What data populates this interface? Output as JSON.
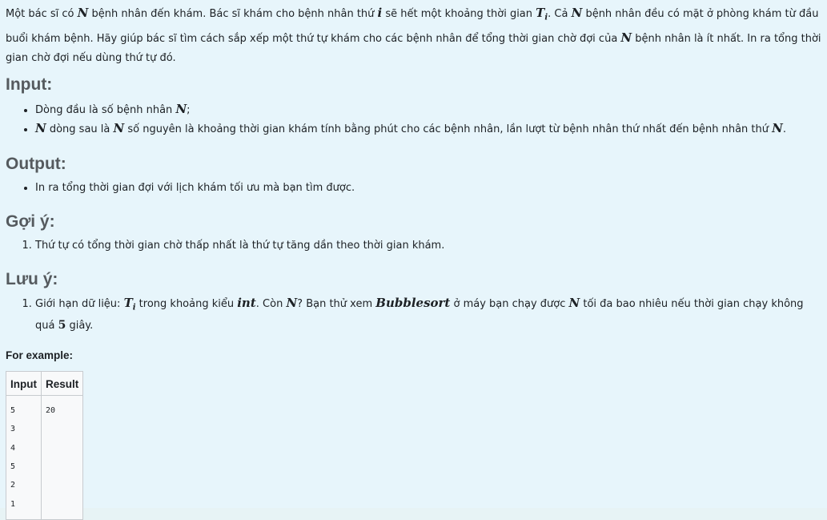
{
  "intro": {
    "s1a": "Một bác sĩ có ",
    "N": "N",
    "s1b": " bệnh nhân đến khám. Bác sĩ khám cho bệnh nhân thứ ",
    "i": "i",
    "s1c": " sẽ hết một khoảng thời gian ",
    "T": "T",
    "sub_i": "i",
    "s1d": ". Cả ",
    "s1e": " bệnh nhân đều có mặt ở phòng khám từ đầu buổi khám bệnh. Hãy giúp bác sĩ tìm cách sắp xếp một thứ tự khám cho các bệnh nhân để tổng thời gian chờ đợi của ",
    "s1f": " bệnh nhân là ít nhất. In ra tổng thời gian chờ đợi nếu dùng thứ tự đó."
  },
  "input_section": {
    "heading": "Input:",
    "item1_a": "Dòng đầu là số bệnh nhân ",
    "item1_math": "N",
    "item1_b": ";",
    "item2_math1": "N",
    "item2_a": " dòng sau là ",
    "item2_math2": "N",
    "item2_b": " số nguyên là khoảng thời gian khám tính bằng phút cho các bệnh nhân, lần lượt từ bệnh nhân thứ nhất đến bệnh nhân thứ ",
    "item2_math3": "N",
    "item2_c": "."
  },
  "output_section": {
    "heading": "Output:",
    "item1": "In ra tổng thời gian đợi với lịch khám tối ưu mà bạn tìm được."
  },
  "hint_section": {
    "heading": "Gợi ý:",
    "item1": "Thứ tự có tổng thời gian chờ thấp nhất là thứ tự tăng dần theo thời gian khám."
  },
  "note_section": {
    "heading": "Lưu ý:",
    "a": "Giới hạn dữ liệu: ",
    "T": "T",
    "sub_i": "i",
    "b": " trong khoảng kiểu ",
    "int": "int",
    "c": ". Còn ",
    "N": "N",
    "d": "? Bạn thử xem ",
    "bubblesort": "Bubblesort",
    "e": " ở máy bạn chạy được ",
    "f": " tối đa bao nhiêu nếu thời gian chạy không quá ",
    "five": "5",
    "g": " giây."
  },
  "example": {
    "label": "For example:",
    "headers": [
      "Input",
      "Result"
    ],
    "input": "5\n3\n4\n5\n2\n1",
    "result": "20"
  }
}
